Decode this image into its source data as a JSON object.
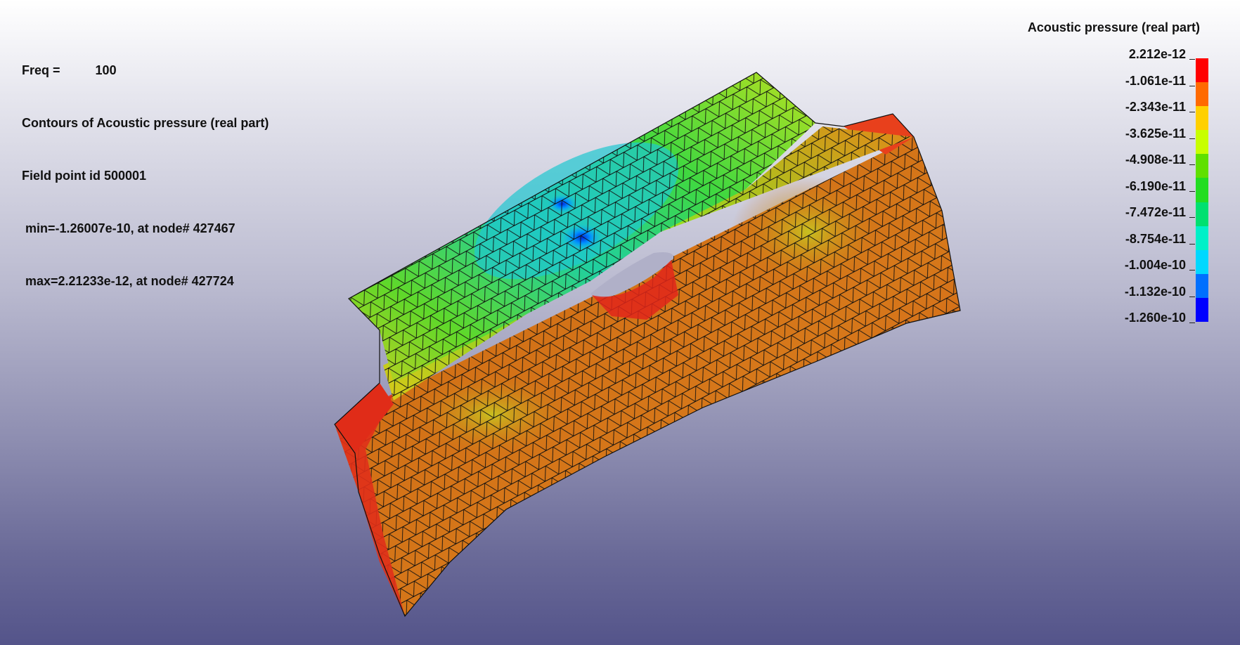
{
  "info": {
    "freq_label": "Freq =",
    "freq_value": "100",
    "title": "Contours of Acoustic pressure (real part)",
    "field_point": "Field point id 500001",
    "min_line": " min=-1.26007e-10, at node# 427467",
    "max_line": " max=2.21233e-12, at node# 427724"
  },
  "legend": {
    "title": "Acoustic pressure (real part)",
    "labels": [
      "2.212e-12",
      "-1.061e-11",
      "-2.343e-11",
      "-3.625e-11",
      "-4.908e-11",
      "-6.190e-11",
      "-7.472e-11",
      "-8.754e-11",
      "-1.004e-10",
      "-1.132e-10",
      "-1.260e-10"
    ],
    "colors": [
      "#ff0000",
      "#ff6a00",
      "#ffd000",
      "#c8ff00",
      "#5fe000",
      "#22dd22",
      "#00e070",
      "#00f0c8",
      "#00d8ff",
      "#0070ff",
      "#0000ff"
    ]
  },
  "model": {
    "name": "fe-mesh",
    "surface_colors": {
      "top_panel": "#5fd82a",
      "top_panel_cool": "#18c8d8",
      "hotspot": "#0030e0",
      "front_face": "#d26a14",
      "edge_red": "#e02c18",
      "yellow": "#c8c818"
    }
  }
}
